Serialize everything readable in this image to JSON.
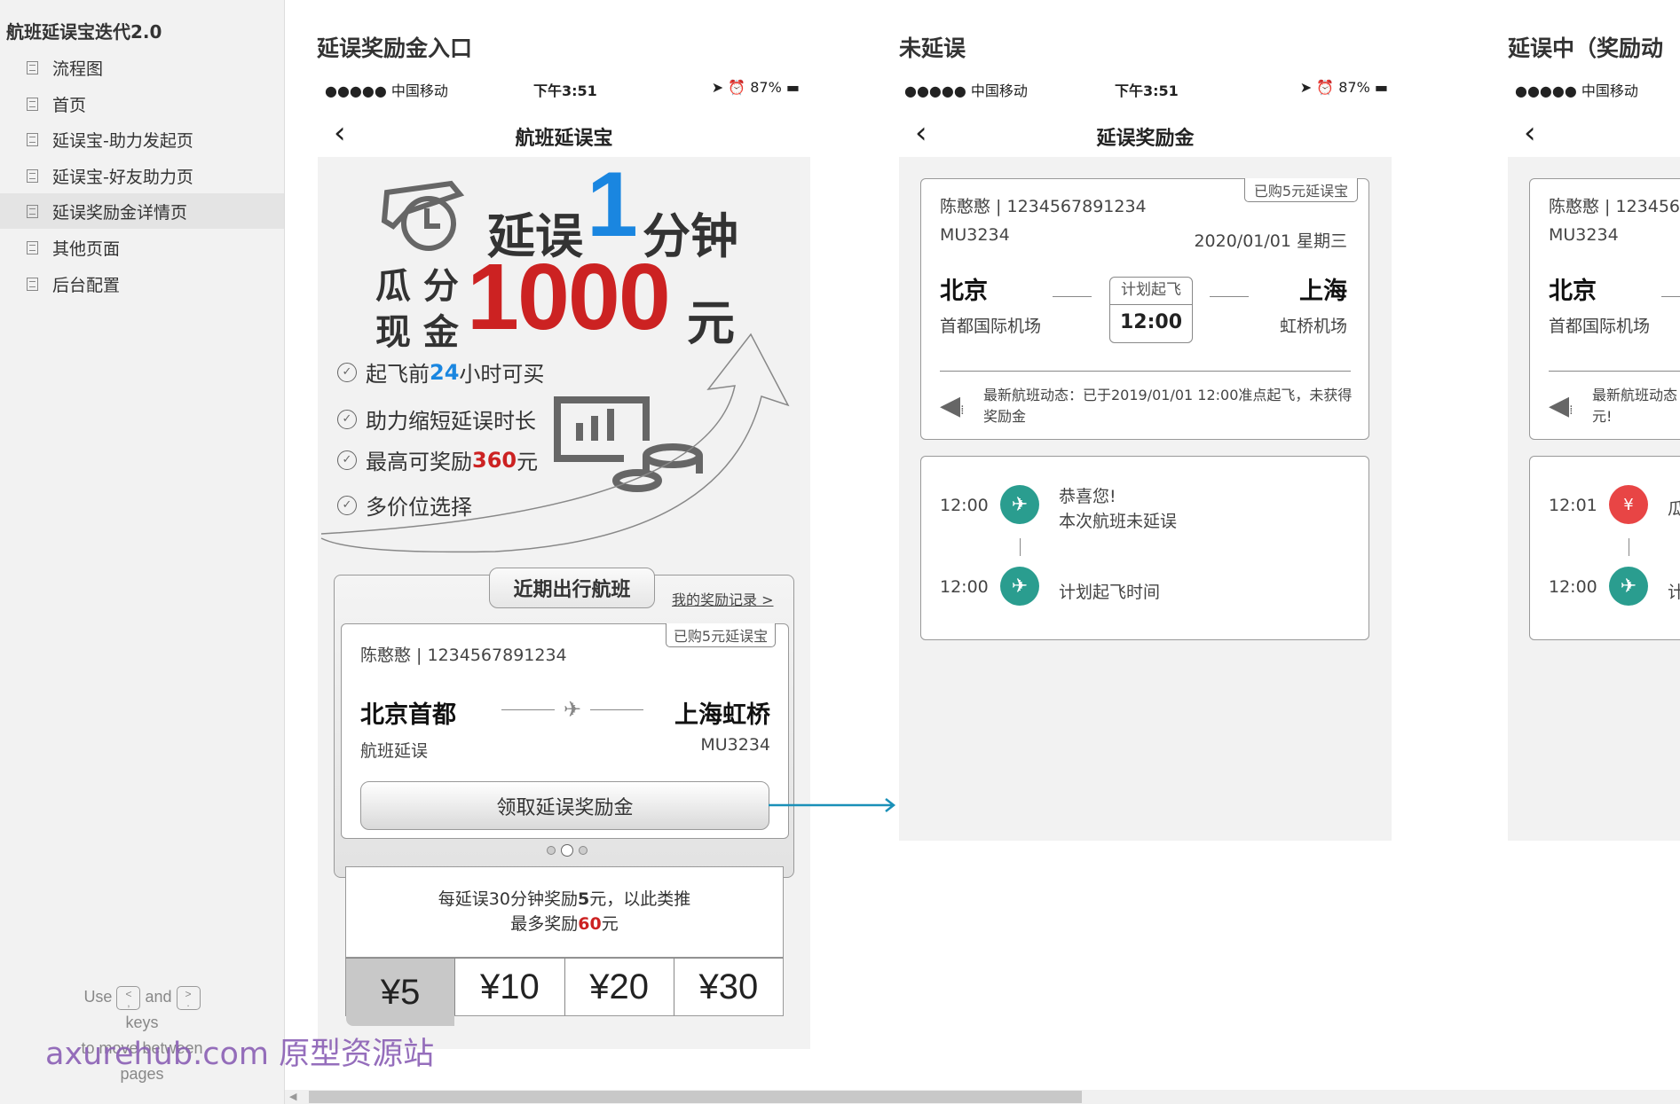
{
  "sidebar": {
    "title": "航班延误宝迭代2.0",
    "items": [
      {
        "label": "流程图"
      },
      {
        "label": "首页"
      },
      {
        "label": "延误宝-助力发起页"
      },
      {
        "label": "延误宝-好友助力页"
      },
      {
        "label": "延误奖励金详情页",
        "selected": true
      },
      {
        "label": "其他页面"
      },
      {
        "label": "后台配置"
      }
    ],
    "help": {
      "use": "Use",
      "prev_key": "<\n,",
      "and": "and",
      "next_key": ">\n.",
      "keys": "keys",
      "move": "to move between",
      "pages": "pages"
    }
  },
  "watermark": "axurehub.com 原型资源站",
  "status_bar": {
    "carrier": "●●●●● 中国移动",
    "time": "下午3:51",
    "battery": "87%"
  },
  "screen1": {
    "section_title": "延误奖励金入口",
    "nav_title": "航班延误宝",
    "banner": {
      "delay": "延误",
      "one": "1",
      "minute": "分钟",
      "split1": "瓜 分",
      "split2": "现 金",
      "amount": "1000",
      "yuan": "元"
    },
    "features": [
      {
        "pre": "起飞前",
        "hl": "24",
        "post": "小时可买",
        "hl_color": "#1a86e0"
      },
      {
        "pre": "助力缩短延误时长",
        "hl": "",
        "post": ""
      },
      {
        "pre": "最高可奖励",
        "hl": "360",
        "post": "元",
        "hl_color": "#cc2222"
      },
      {
        "pre": "多价位选择",
        "hl": "",
        "post": ""
      }
    ],
    "tab_label": "近期出行航班",
    "records_link": "我的奖励记录 >",
    "card": {
      "badge": "已购5元延误宝",
      "passenger": "陈憨憨 | 1234567891234",
      "from": "北京首都",
      "to": "上海虹桥",
      "status": "航班延误",
      "flight": "MU3234",
      "button": "领取延误奖励金"
    },
    "rule": {
      "line1_pre": "每延误30分钟奖励",
      "line1_bold": "5",
      "line1_post": "元，以此类推",
      "line2_pre": "最多奖励",
      "line2_hl": "60",
      "line2_post": "元"
    },
    "prices": [
      {
        "label": "¥5",
        "selected": true
      },
      {
        "label": "¥10"
      },
      {
        "label": "¥20"
      },
      {
        "label": "¥30"
      }
    ],
    "carousel_active": 2
  },
  "screen2": {
    "section_title": "未延误",
    "nav_title": "延误奖励金",
    "card": {
      "badge": "已购5元延误宝",
      "passenger": "陈憨憨 | 1234567891234",
      "flight": "MU3234",
      "date": "2020/01/01 星期三",
      "from": "北京",
      "from_airport": "首都国际机场",
      "to": "上海",
      "to_airport": "虹桥机场",
      "plan_label": "计划起飞",
      "plan_time": "12:00",
      "news": "最新航班动态：已于2019/01/01  12:00准点起飞，未获得奖励金"
    },
    "timeline": [
      {
        "time": "12:00",
        "icon": "plane-icon",
        "line1": "恭喜您!",
        "line2": "本次航班未延误"
      },
      {
        "time": "12:00",
        "icon": "plane-icon",
        "line1": "计划起飞时间",
        "line2": ""
      }
    ]
  },
  "screen3": {
    "section_title": "延误中（奖励动",
    "card": {
      "passenger": "陈憨憨 | 123456",
      "flight": "MU3234",
      "from": "北京",
      "from_airport": "首都国际机场",
      "news1": "最新航班动态",
      "news2": "元!"
    },
    "timeline": [
      {
        "time": "12:01",
        "icon": "red-envelope-icon",
        "text": "瓜"
      },
      {
        "time": "12:00",
        "icon": "plane-icon",
        "text": "计"
      }
    ]
  },
  "colors": {
    "accent_blue": "#1a86e0",
    "accent_red": "#cc2222",
    "teal": "#2a9d8f",
    "link_arrow": "#1a90b8",
    "watermark": "#8a5fb5"
  }
}
